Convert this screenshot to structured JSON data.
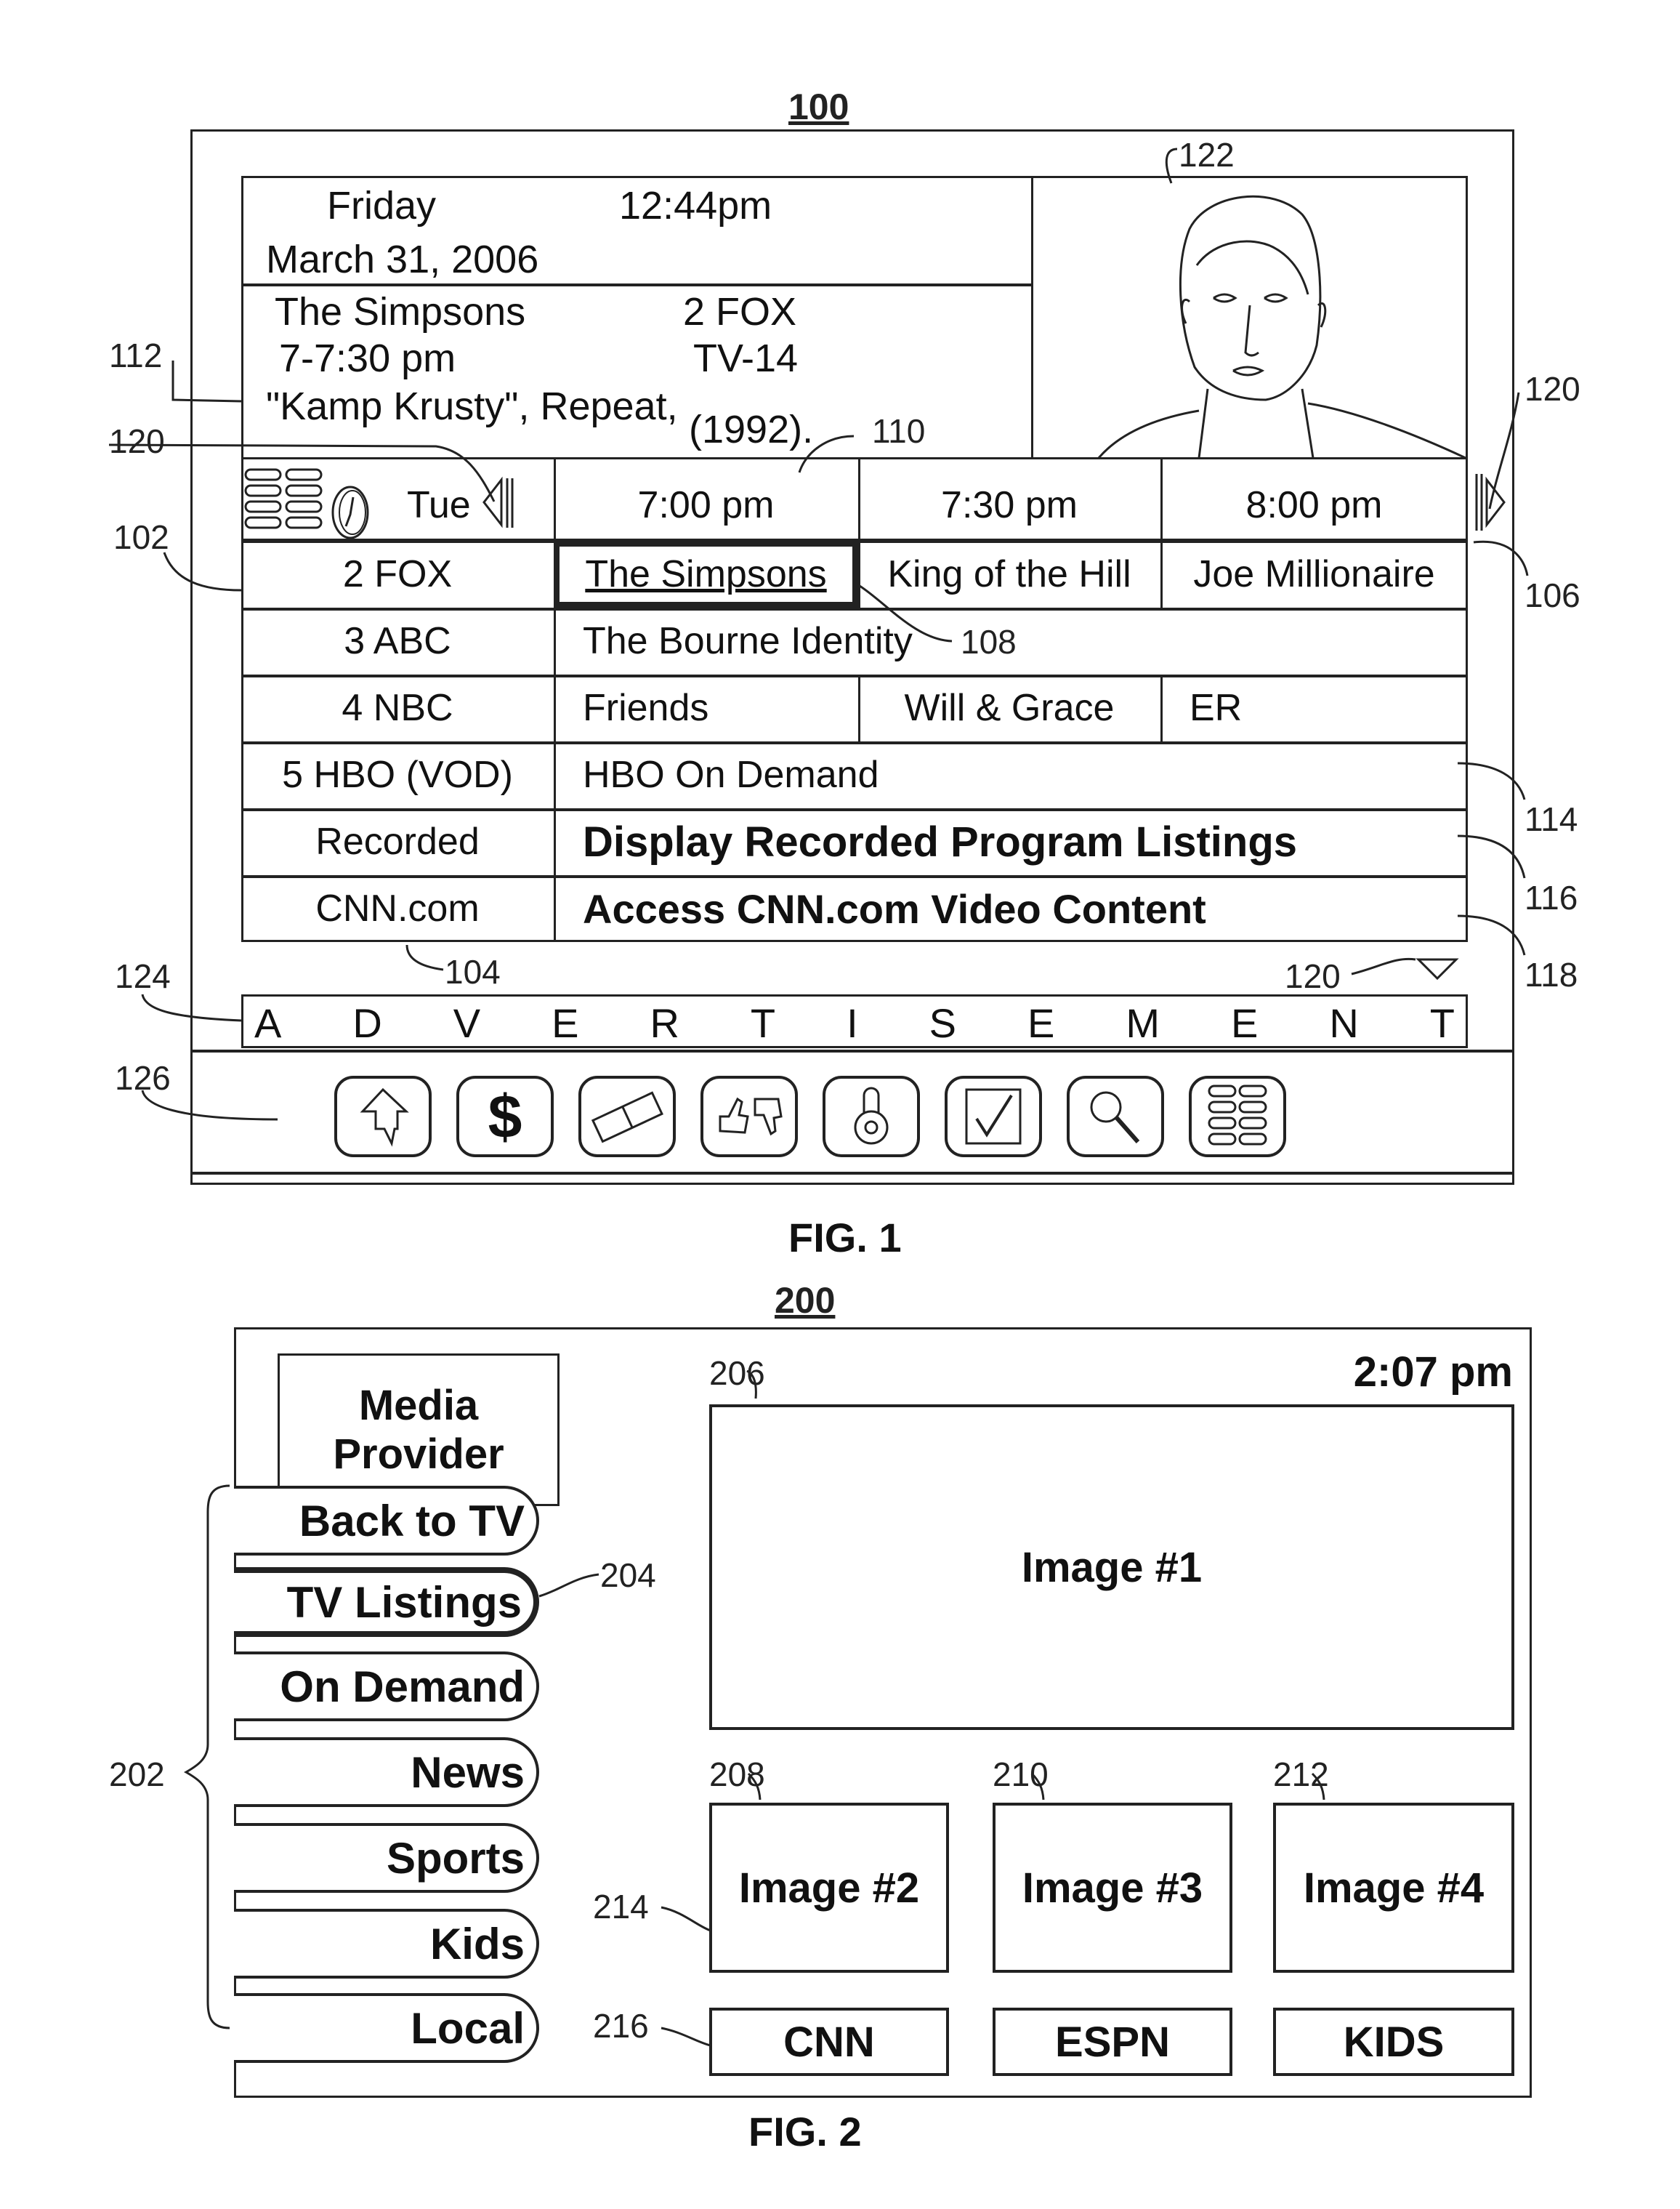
{
  "fig1": {
    "ref_number": "100",
    "caption": "FIG. 1",
    "header": {
      "day": "Friday",
      "time": "12:44pm",
      "date": "March 31, 2006"
    },
    "program_info": {
      "title": "The Simpsons",
      "channel": "2 FOX",
      "time_range": "7-7:30 pm",
      "rating": "TV-14",
      "episode": "\"Kamp Krusty\", Repeat,",
      "year": "(1992)."
    },
    "grid": {
      "day_label": "Tue",
      "time_slots": [
        "7:00 pm",
        "7:30 pm",
        "8:00 pm"
      ],
      "rows": [
        {
          "channel": "2 FOX",
          "programs": [
            "The Simpsons",
            "King of the Hill",
            "Joe Millionaire"
          ]
        },
        {
          "channel": "3 ABC",
          "programs": [
            "The Bourne Identity"
          ]
        },
        {
          "channel": "4 NBC",
          "programs": [
            "Friends",
            "Will & Grace",
            "ER"
          ]
        },
        {
          "channel": "5 HBO (VOD)",
          "programs": [
            "HBO On Demand"
          ]
        },
        {
          "channel": "Recorded",
          "programs": [
            "Display Recorded Program Listings"
          ]
        },
        {
          "channel": "CNN.com",
          "programs": [
            "Access CNN.com Video Content"
          ]
        }
      ],
      "selected_program": "The Simpsons"
    },
    "advertisement": [
      "A",
      "D",
      "V",
      "E",
      "R",
      "T",
      "I",
      "S",
      "E",
      "M",
      "E",
      "N",
      "T"
    ],
    "toolbar_icons": [
      "back-arrow-icon",
      "dollar-icon",
      "ticket-icon",
      "thumbs-up-down-icon",
      "lock-icon",
      "checkbox-icon",
      "search-icon",
      "menu-list-icon"
    ],
    "reference_labels": {
      "r102": "102",
      "r104": "104",
      "r106": "106",
      "r108": "108",
      "r110": "110",
      "r112": "112",
      "r114": "114",
      "r116": "116",
      "r118": "118",
      "r120a": "120",
      "r120b": "120",
      "r120c": "120",
      "r122": "122",
      "r124": "124",
      "r126": "126"
    }
  },
  "fig2": {
    "ref_number": "200",
    "caption": "FIG. 2",
    "provider_label": "Media Provider",
    "clock": "2:07 pm",
    "nav_items": [
      {
        "label": "Back to TV",
        "selected": false
      },
      {
        "label": "TV Listings",
        "selected": true
      },
      {
        "label": "On Demand",
        "selected": false
      },
      {
        "label": "News",
        "selected": false
      },
      {
        "label": "Sports",
        "selected": false
      },
      {
        "label": "Kids",
        "selected": false
      },
      {
        "label": "Local",
        "selected": false
      }
    ],
    "main_image": "Image #1",
    "thumbnails": [
      "Image #2",
      "Image #3",
      "Image #4"
    ],
    "channel_buttons": [
      "CNN",
      "ESPN",
      "KIDS"
    ],
    "reference_labels": {
      "r202": "202",
      "r204": "204",
      "r206": "206",
      "r208": "208",
      "r210": "210",
      "r212": "212",
      "r214": "214",
      "r216": "216"
    }
  }
}
